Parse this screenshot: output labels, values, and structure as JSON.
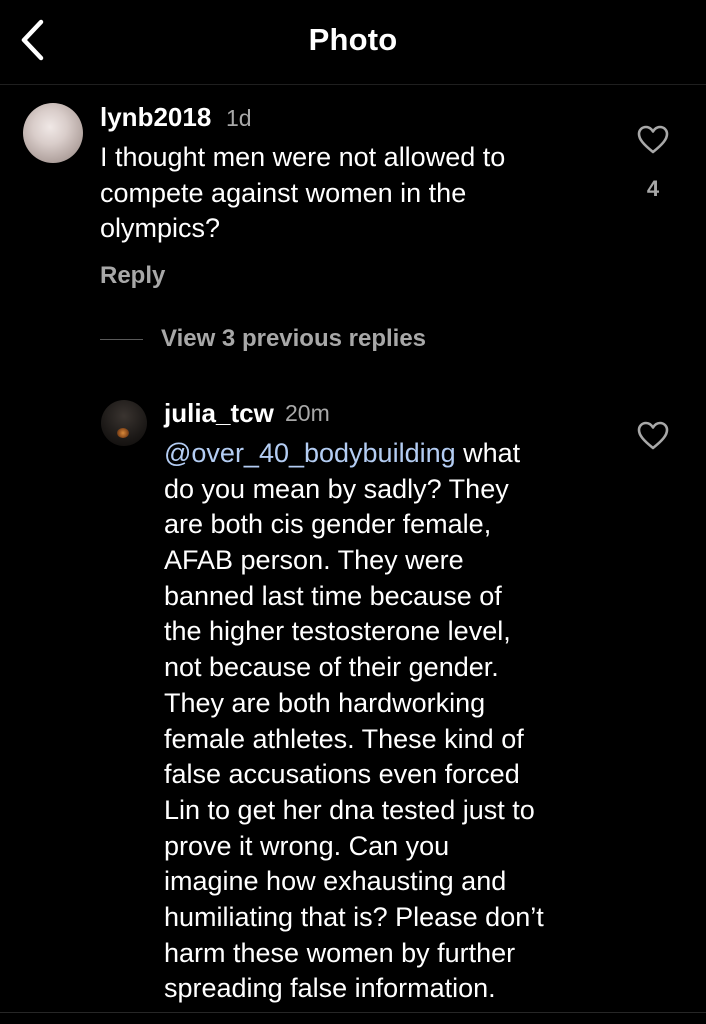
{
  "header": {
    "title": "Photo",
    "back_icon": "chevron-left-icon"
  },
  "comments": [
    {
      "username": "lynb2018",
      "timestamp": "1d",
      "lines": [
        "I thought men were not allowed to",
        "compete against women in the",
        "olympics?"
      ],
      "reply_label": "Reply",
      "like_count": "4",
      "like_icon": "heart-outline-icon"
    },
    {
      "username": "julia_tcw",
      "timestamp": "20m",
      "mention": "@over_40_bodybuilding",
      "first_line_rest": " what",
      "lines": [
        "do you mean by sadly? They",
        "are both cis gender female,",
        "AFAB person. They were",
        "banned last time because of",
        "the higher testosterone level,",
        "not because of their gender.",
        "They are both hardworking",
        "female athletes. These kind of",
        "false accusations even forced",
        "Lin to get her dna tested just to",
        "prove it wrong. Can you",
        "imagine how exhausting and",
        "humiliating that is? Please don’t",
        "harm these women by further",
        "spreading false information."
      ],
      "like_icon": "heart-outline-icon"
    }
  ],
  "replies_toggle": {
    "label": "View 3 previous replies"
  },
  "colors": {
    "background": "#000000",
    "text": "#ffffff",
    "secondary_text": "#a8a8a8",
    "mention": "#b4cdf3"
  }
}
